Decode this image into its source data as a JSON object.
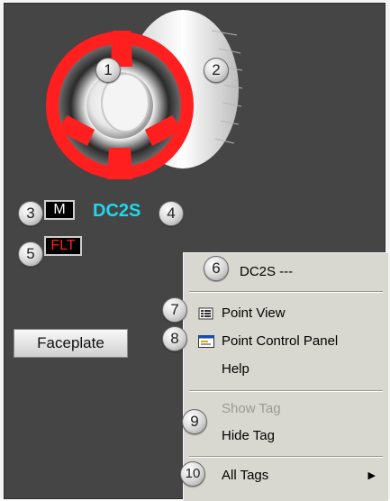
{
  "device": {
    "tag": "DC2S",
    "mode_label": "M",
    "fault_label": "FLT",
    "colors": {
      "tag_text": "#1fd7ee",
      "fault_text": "#ff2020",
      "valve_red": "#ff1f1f",
      "background": "#454545"
    }
  },
  "faceplate_button": {
    "label": "Faceplate"
  },
  "context_menu": {
    "header": "DC2S ---",
    "items": [
      {
        "label": "Point View",
        "icon": "point-view-icon",
        "enabled": true
      },
      {
        "label": "Point Control Panel",
        "icon": "control-panel-icon",
        "enabled": true
      },
      {
        "label": "Help",
        "enabled": true
      },
      {
        "label": "Show Tag",
        "enabled": false
      },
      {
        "label": "Hide Tag",
        "enabled": true
      },
      {
        "label": "All Tags",
        "enabled": true,
        "submenu": true
      }
    ]
  },
  "callouts": [
    "1",
    "2",
    "3",
    "4",
    "5",
    "6",
    "7",
    "8",
    "9",
    "10"
  ]
}
